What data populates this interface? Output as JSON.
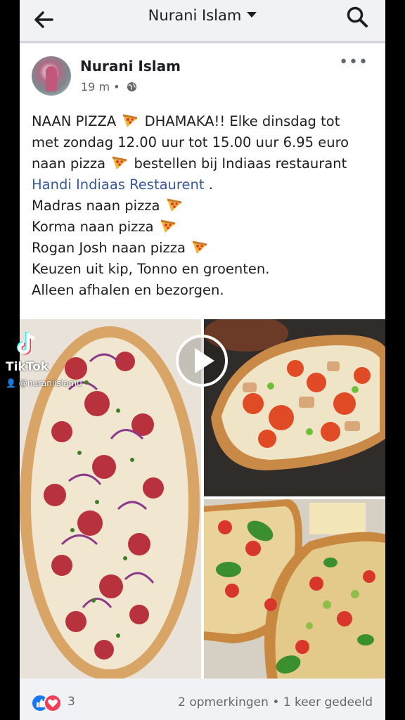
{
  "header": {
    "title": "Nurani Islam",
    "back_icon": "arrow-left-icon",
    "search_icon": "search-icon"
  },
  "post": {
    "author": "Nurani Islam",
    "time": "19 m",
    "separator": "•",
    "privacy_icon": "globe-icon",
    "more_label": "•••",
    "lines": {
      "l1a": "NAAN PIZZA",
      "l1b": "DHAMAKA!! Elke dinsdag tot",
      "l2": "met zondag 12.00 uur tot 15.00 uur 6.95 euro",
      "l3a": "naan pizza",
      "l3b": "bestellen bij Indiaas restaurant",
      "link": "Handi Indiaas Restaurent",
      "link_after": " .",
      "l5": "Madras naan pizza",
      "l6": "Korma naan pizza",
      "l7": "Rogan Josh naan pizza",
      "l8": "Keuzen uit kip, Tonno en groenten.",
      "l9": "Alleen afhalen en bezorgen."
    }
  },
  "overlay": {
    "tiktok_label": "TikTok",
    "tiktok_user": "@nuraniislamu",
    "play_icon": "play-icon"
  },
  "footer": {
    "reaction_count": "3",
    "stats": "2 opmerkingen • 1 keer gedeeld"
  },
  "colors": {
    "link": "#385898",
    "like": "#1877f2",
    "love": "#f33e58"
  }
}
